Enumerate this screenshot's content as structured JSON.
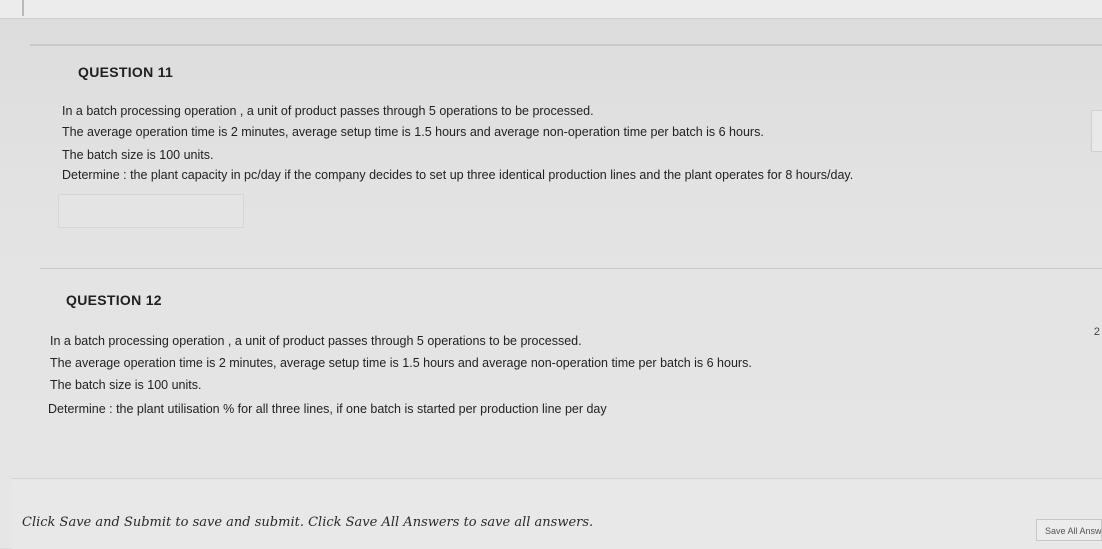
{
  "questions": [
    {
      "title": "QUESTION 11",
      "lines": [
        "In a batch processing operation , a unit of product passes through 5 operations to be processed.",
        "The average operation time is 2 minutes, average setup time is 1.5 hours and average non-operation time per batch is 6 hours.",
        "The batch size is 100 units.",
        "Determine : the plant capacity in pc/day if the company decides to set up three identical production lines and the plant operates for 8 hours/day."
      ]
    },
    {
      "title": "QUESTION 12",
      "lines": [
        "In a batch processing operation , a unit of product passes through 5 operations to be processed.",
        "The average operation time is 2 minutes, average setup time is 1.5 hours and average non-operation time per batch is 6 hours.",
        "The batch size is 100 units.",
        "Determine : the plant utilisation % for all three lines,  if one batch is started per production line per day"
      ]
    }
  ],
  "side_page_marker": "2",
  "footer": {
    "instruction": "Click Save and Submit to save and submit. Click Save All Answers to save all answers.",
    "save_all_label": "Save All Answers"
  }
}
